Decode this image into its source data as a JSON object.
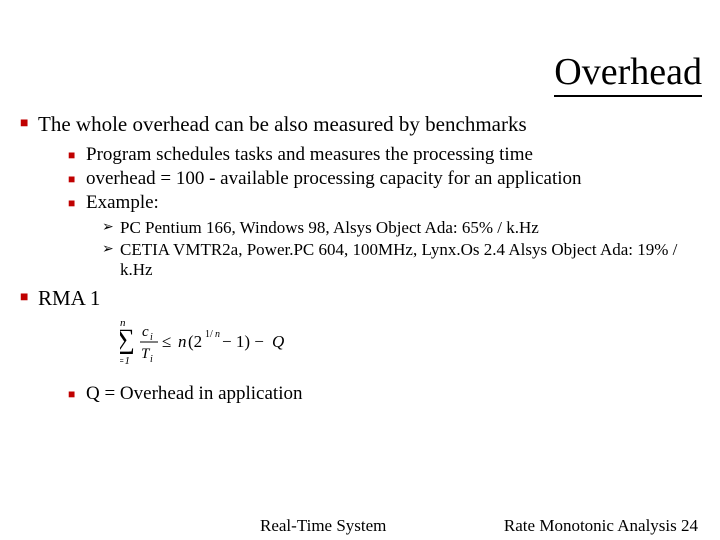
{
  "title": "Overhead",
  "bullets": {
    "b1": "The whole overhead can be also measured by benchmarks",
    "b1_1": "Program schedules tasks and measures the processing time",
    "b1_2": "overhead = 100 -  available processing capacity for an application",
    "b1_3": "Example:",
    "b1_3_1": "PC Pentium 166, Windows 98, Alsys Object Ada: 65% / k.Hz",
    "b1_3_2": "CETIA VMTR2a, Power.PC 604, 100MHz, Lynx.Os 2.4 Alsys Object Ada: 19% / k.Hz",
    "b2": "RMA 1",
    "b2_1": "Q = Overhead in application"
  },
  "footer": {
    "center": "Real-Time System",
    "right": "Rate Monotonic Analysis 24"
  }
}
